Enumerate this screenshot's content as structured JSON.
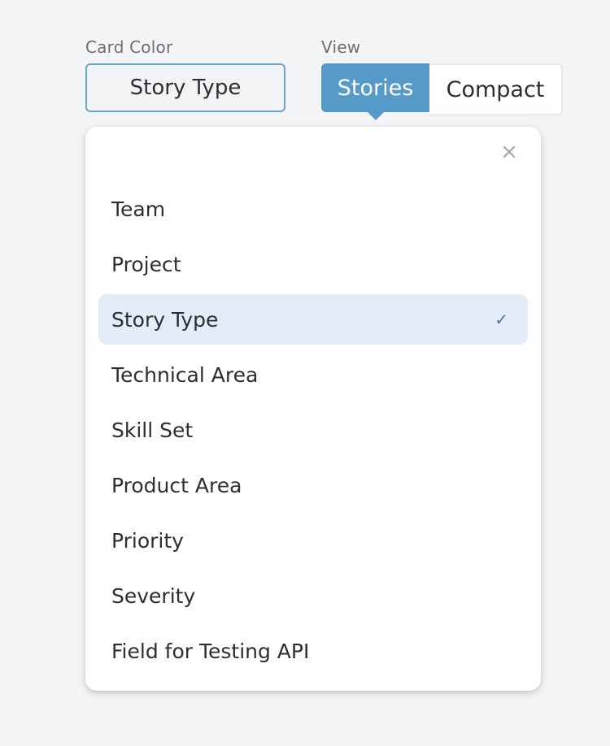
{
  "controls": {
    "card_color_label": "Card Color",
    "card_color_value": "Story Type",
    "view_label": "View",
    "view_options": [
      "Stories",
      "Compact"
    ],
    "view_selected": "Stories"
  },
  "dropdown": {
    "close_icon": "close-icon",
    "close_symbol": "×",
    "items": [
      {
        "label": "Team"
      },
      {
        "label": "Project"
      },
      {
        "label": "Story Type",
        "selected": true
      },
      {
        "label": "Technical Area"
      },
      {
        "label": "Skill Set"
      },
      {
        "label": "Product Area"
      },
      {
        "label": "Priority"
      },
      {
        "label": "Severity"
      },
      {
        "label": "Field for Testing API"
      }
    ],
    "check_icon": "check-icon",
    "check_symbol": "✓"
  },
  "colors": {
    "accent": "#559ac9",
    "selected_bg": "#e2edf8",
    "border_focus": "#6aa6cf"
  }
}
